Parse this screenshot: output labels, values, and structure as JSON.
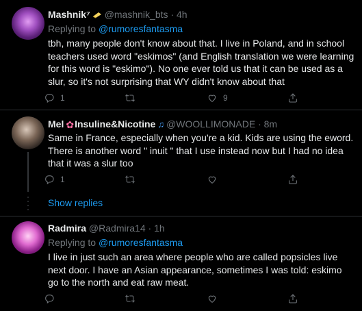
{
  "tweets": [
    {
      "display_name": "Mashnik",
      "name_suffix": "⁷",
      "handle": "@mashnik_bts",
      "separator": "·",
      "time": "4h",
      "replying_label": "Replying to",
      "replying_to": "@rumoresfantasma",
      "text": "tbh, many people don't know about that. I live in Poland, and in school teachers used word \"eskimos\" (and English translation we were learning for this word is \"eskimo\"). No one ever told us that it can be used as a slur, so it's not surprising that WY didn't know about that",
      "reply_count": "1",
      "retweet_count": "",
      "like_count": "9"
    },
    {
      "display_name_1": "Mel",
      "display_name_2": "Insuline&Nicotine",
      "handle": "@WOOLLIMONADE",
      "separator": "·",
      "time": "8m",
      "text": "Same in France, especially when you're a kid. Kids are using the eword. There is another word \"  inuit \" that I use instead now but I had no idea that it was a slur too",
      "reply_count": "1",
      "retweet_count": "",
      "like_count": ""
    },
    {
      "display_name": "Radmira",
      "handle": "@Radmira14",
      "separator": "·",
      "time": "1h",
      "replying_label": "Replying to",
      "replying_to": "@rumoresfantasma",
      "text": "I live in just such an area where people who are called popsicles live next door. I have an Asian appearance, sometimes I was told: eskimo go to the north and eat raw meat.",
      "reply_count": "",
      "retweet_count": "",
      "like_count": ""
    }
  ],
  "show_replies_label": "Show replies",
  "icons": {
    "reply": "reply-icon",
    "retweet": "retweet-icon",
    "like": "heart-icon",
    "share": "share-icon",
    "flower": "flower-icon",
    "music": "music-note-icon",
    "badge": "yellow-badge-icon"
  },
  "colors": {
    "background": "#000000",
    "text": "#e7e9ea",
    "muted": "#71767b",
    "link": "#1d9bf0",
    "divider": "#2f3336"
  }
}
